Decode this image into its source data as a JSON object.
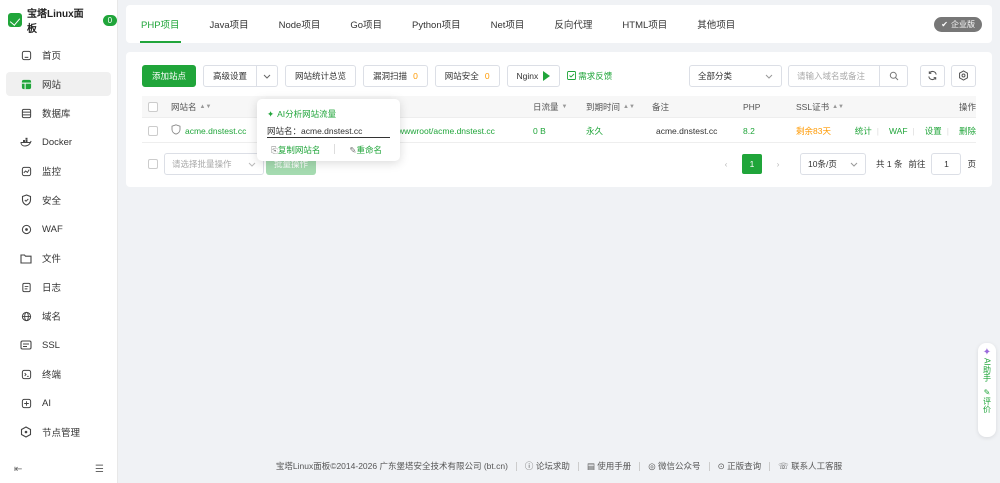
{
  "brand": {
    "title": "宝塔Linux面板",
    "badge": "0"
  },
  "sidebar": {
    "items": [
      {
        "label": "首页",
        "icon": "home-icon"
      },
      {
        "label": "网站",
        "icon": "website-icon",
        "active": true
      },
      {
        "label": "数据库",
        "icon": "database-icon"
      },
      {
        "label": "Docker",
        "icon": "docker-icon"
      },
      {
        "label": "监控",
        "icon": "monitor-icon"
      },
      {
        "label": "安全",
        "icon": "shield-icon"
      },
      {
        "label": "WAF",
        "icon": "waf-icon"
      },
      {
        "label": "文件",
        "icon": "folder-icon"
      },
      {
        "label": "日志",
        "icon": "log-icon"
      },
      {
        "label": "域名",
        "icon": "globe-icon"
      },
      {
        "label": "SSL",
        "icon": "ssl-icon"
      },
      {
        "label": "终端",
        "icon": "terminal-icon"
      },
      {
        "label": "AI",
        "icon": "ai-icon"
      },
      {
        "label": "节点管理",
        "icon": "node-icon"
      }
    ]
  },
  "tabs": [
    "PHP项目",
    "Java项目",
    "Node项目",
    "Go项目",
    "Python项目",
    "Net项目",
    "反向代理",
    "HTML项目",
    "其他项目"
  ],
  "enterprise_label": "企业版",
  "toolbar": {
    "add_site": "添加站点",
    "advanced": "高级设置",
    "stats": "网站统计总览",
    "vuln_scan": "漏洞扫描",
    "vuln_count": "0",
    "site_security": "网站安全",
    "security_count": "0",
    "nginx": "Nginx",
    "feedback": "需求反馈",
    "category": "全部分类",
    "search_placeholder": "请输入域名或备注"
  },
  "table": {
    "headers": {
      "name": "网站名",
      "traffic": "日流量",
      "expire": "到期时间",
      "remark": "备注",
      "php": "PHP",
      "ssl": "SSL证书",
      "ops": "操作"
    },
    "rows": [
      {
        "name": "acme.dnstest.cc",
        "path": "wwwroot/acme.dnstest.cc",
        "traffic": "0 B",
        "expire": "永久",
        "remark": "acme.dnstest.cc",
        "php": "8.2",
        "ssl": "剩余83天",
        "ops": [
          "统计",
          "WAF",
          "设置",
          "删除"
        ]
      }
    ]
  },
  "batch": {
    "placeholder": "请选择批量操作",
    "button": "批量操作"
  },
  "pager": {
    "current": "1",
    "size": "10条/页",
    "total": "共 1 条",
    "goto": "前往",
    "goto_value": "1",
    "unit": "页"
  },
  "popover": {
    "ai": "AI分析网站流量",
    "name_label": "网站名：",
    "name_value": "acme.dnstest.cc",
    "copy": "复制网站名",
    "rename": "重命名"
  },
  "footer": {
    "copyright": "宝塔Linux面板©2014-2026 广东堡塔安全技术有限公司 (bt.cn)",
    "links": [
      "论坛求助",
      "使用手册",
      "微信公众号",
      "正版查询",
      "联系人工客服"
    ]
  },
  "ai_float": {
    "assistant": "AI助手",
    "rate": "评价"
  },
  "colors": {
    "accent": "#20a53a",
    "warning": "#ff9900"
  }
}
